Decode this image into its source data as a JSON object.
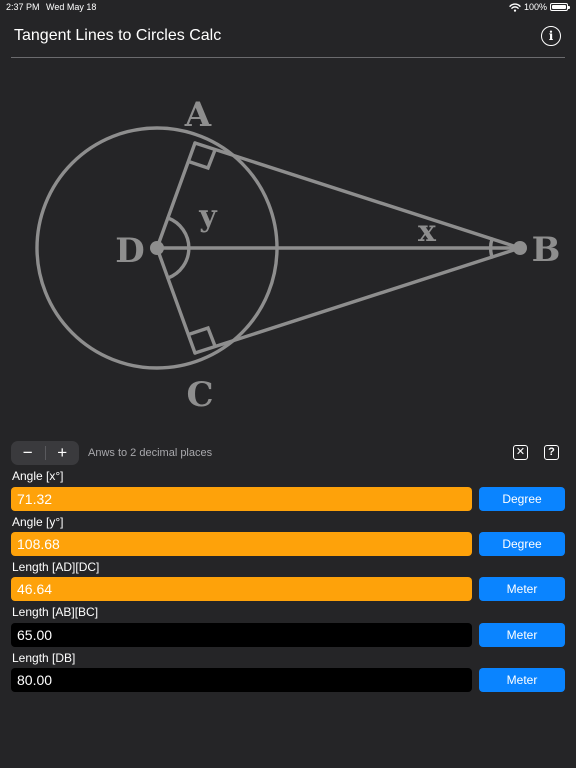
{
  "status_bar": {
    "time": "2:37 PM",
    "date": "Wed May 18",
    "battery": "100%",
    "battery_level_percent": 100,
    "wifi_icon": "wifi-icon"
  },
  "nav": {
    "title": "Tangent Lines to Circles Calc",
    "info_icon": "info-icon",
    "info_glyph": "i"
  },
  "diagram": {
    "point_a": "A",
    "point_b": "B",
    "point_c": "C",
    "point_d": "D",
    "angle_x": "x",
    "angle_y": "y",
    "line_color": "#8e8e8e"
  },
  "controls": {
    "minus_label": "−",
    "plus_label": "+",
    "precision_text": "Anws to 2 decimal places",
    "clear_icon": "clear-x-icon",
    "clear_glyph": "✕",
    "help_icon": "help-icon",
    "help_glyph": "?"
  },
  "fields": [
    {
      "label": "Angle [x°]",
      "value": "71.32",
      "unit": "Degree",
      "kind": "result"
    },
    {
      "label": "Angle [y°]",
      "value": "108.68",
      "unit": "Degree",
      "kind": "result"
    },
    {
      "label": "Length [AD][DC]",
      "value": "46.64",
      "unit": "Meter",
      "kind": "result"
    },
    {
      "label": "Length [AB][BC]",
      "value": "65.00",
      "unit": "Meter",
      "kind": "given"
    },
    {
      "label": "Length [DB]",
      "value": "80.00",
      "unit": "Meter",
      "kind": "given"
    }
  ],
  "colors": {
    "background": "#252527",
    "result_field": "#fea20a",
    "input_field": "#000000",
    "unit_button": "#0a84ff"
  }
}
